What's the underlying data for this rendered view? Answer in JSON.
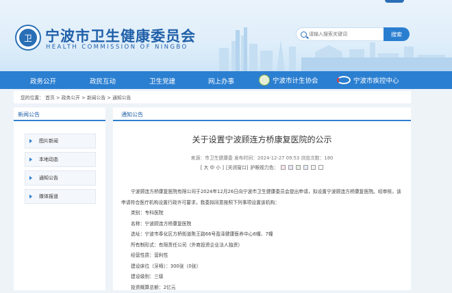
{
  "header": {
    "title": "宁波市卫生健康委员会",
    "subtitle": "HEALTH COMMISSION OF NINGBO",
    "search_placeholder": "请输入搜索关键词",
    "search_button": "搜索"
  },
  "nav": {
    "items": [
      "政务公开",
      "政民互动",
      "卫生党建",
      "网上办事",
      "宁波市计生协会",
      "宁波市疾控中心"
    ]
  },
  "breadcrumb": "您的位置： 首页 > 政务公开 > 新闻公告 > 通知公告",
  "sidebar": {
    "heading": "新闻公告",
    "items": [
      "图片新闻",
      "本地动态",
      "通知公告",
      "媒体报道"
    ]
  },
  "main": {
    "heading": "通知公告",
    "article_title": "关于设置宁波顾连方桥康复医院的公示",
    "meta": "来源：市卫生健康委     发布时间：2024-12-27 09:53     浏览次数：180",
    "font_sizes": "[ 大 中 小 ]",
    "close_window": "[关闭窗口]",
    "eye_mode": "护眼视力色：",
    "swatch_colors": [
      "#fde6f0",
      "#e9e6f7",
      "#e4f0e0",
      "#e6ecf7",
      "#f3f3f3",
      "#ffffff"
    ],
    "paragraph1": "宁波顾连方桥康复医院有限公司于2024年12月26日向宁波市卫生健康委员会提出申请，拟设置宁波顾连方桥康复医院。经审核，该申请符合医疗机构设置行政许可要求，我委拟同意按照下列事项设置该机构：",
    "fields": [
      "类别：专科医院",
      "名称：宁波顾连方桥康复医院",
      "选址：宁波市奉化区方桥街道陈王路66号盈泽健康医养中心6幢、7幢",
      "所有制形式：有限责任公司（外商投资企业法人独资）",
      "经营性质：营利性",
      "建设床位（牙椅）：300张（0张）",
      "建设级别：三级",
      "投资概算总额：2亿元"
    ]
  }
}
